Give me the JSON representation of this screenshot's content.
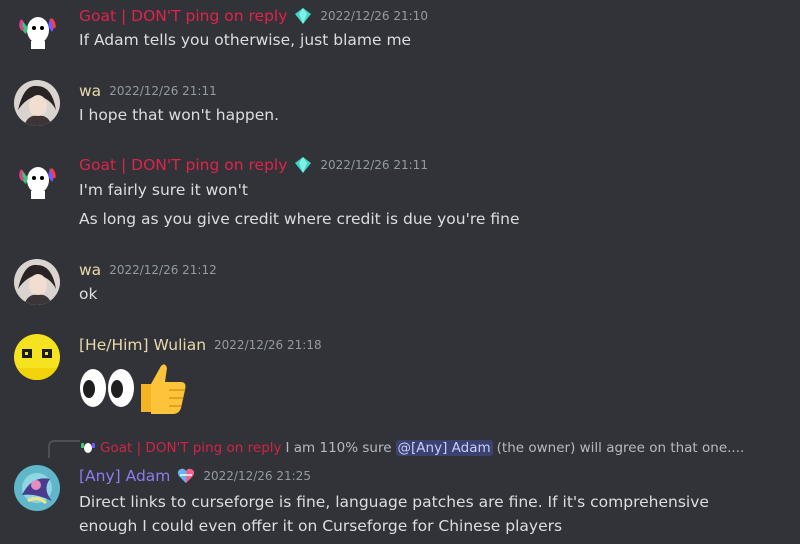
{
  "colors": {
    "goat": "#e0234a",
    "wa": "#e8d9a9",
    "wulian": "#e8d9a9",
    "adam": "#8c7cf0"
  },
  "messages": [
    {
      "user": "Goat | DON'T ping on reply",
      "badge": "diamond-icon",
      "timestamp": "2022/12/26 21:10",
      "lines": [
        "If Adam tells you otherwise, just blame me"
      ]
    },
    {
      "user": "wa",
      "timestamp": "2022/12/26 21:11",
      "lines": [
        "I hope that won't happen."
      ]
    },
    {
      "user": "Goat | DON'T ping on reply",
      "badge": "diamond-icon",
      "timestamp": "2022/12/26 21:11",
      "lines": [
        "I'm fairly sure it won't",
        "As long as you give credit where credit is due you're fine"
      ]
    },
    {
      "user": "wa",
      "timestamp": "2022/12/26 21:12",
      "lines": [
        "ok"
      ]
    },
    {
      "user": "[He/Him] Wulian",
      "timestamp": "2022/12/26 21:18",
      "emoji": [
        "eyes-emoji",
        "thumbs-up-emoji"
      ]
    },
    {
      "user": "[Any] Adam",
      "badge": "heart-icon",
      "timestamp": "2022/12/26 21:25",
      "reply": {
        "user": "Goat | DON'T ping on reply",
        "pre": "I am 110% sure",
        "mention": "@[Any] Adam",
        "post": "(the owner) will agree on that one...."
      },
      "lines": [
        "Direct links to curseforge is fine, language patches are fine. If it's comprehensive",
        "enough I could even offer it on Curseforge for Chinese players"
      ]
    }
  ]
}
